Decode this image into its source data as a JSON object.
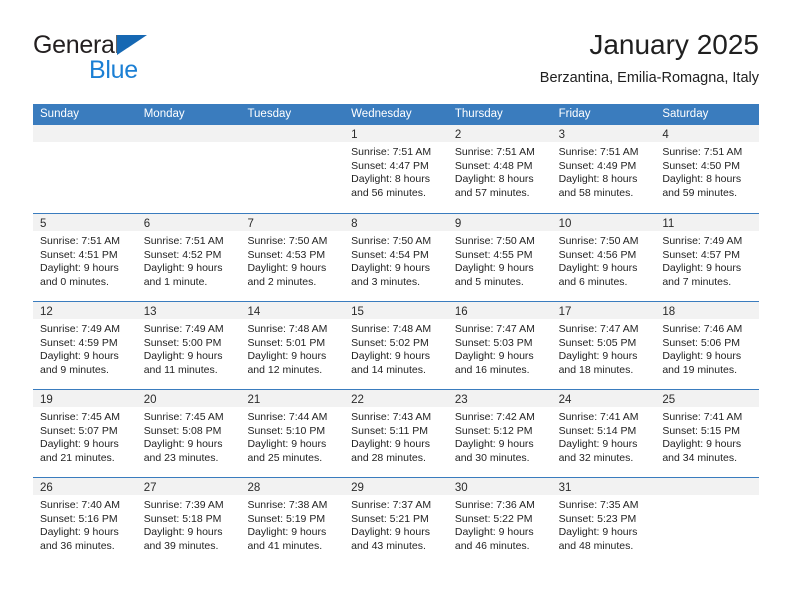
{
  "brand": {
    "line1": "General",
    "line2": "Blue",
    "triangle_color": "#1668b3",
    "line2_color": "#1b7fd4"
  },
  "header": {
    "title": "January 2025",
    "subtitle": "Berzantina, Emilia-Romagna, Italy"
  },
  "theme": {
    "header_blue": "#3a7cbe",
    "daynum_strip": "#f2f2f2",
    "text": "#232323"
  },
  "weekdays": [
    "Sunday",
    "Monday",
    "Tuesday",
    "Wednesday",
    "Thursday",
    "Friday",
    "Saturday"
  ],
  "weeks": [
    [
      {
        "day": "",
        "lines": []
      },
      {
        "day": "",
        "lines": []
      },
      {
        "day": "",
        "lines": []
      },
      {
        "day": "1",
        "lines": [
          "Sunrise: 7:51 AM",
          "Sunset: 4:47 PM",
          "Daylight: 8 hours",
          "and 56 minutes."
        ]
      },
      {
        "day": "2",
        "lines": [
          "Sunrise: 7:51 AM",
          "Sunset: 4:48 PM",
          "Daylight: 8 hours",
          "and 57 minutes."
        ]
      },
      {
        "day": "3",
        "lines": [
          "Sunrise: 7:51 AM",
          "Sunset: 4:49 PM",
          "Daylight: 8 hours",
          "and 58 minutes."
        ]
      },
      {
        "day": "4",
        "lines": [
          "Sunrise: 7:51 AM",
          "Sunset: 4:50 PM",
          "Daylight: 8 hours",
          "and 59 minutes."
        ]
      }
    ],
    [
      {
        "day": "5",
        "lines": [
          "Sunrise: 7:51 AM",
          "Sunset: 4:51 PM",
          "Daylight: 9 hours",
          "and 0 minutes."
        ]
      },
      {
        "day": "6",
        "lines": [
          "Sunrise: 7:51 AM",
          "Sunset: 4:52 PM",
          "Daylight: 9 hours",
          "and 1 minute."
        ]
      },
      {
        "day": "7",
        "lines": [
          "Sunrise: 7:50 AM",
          "Sunset: 4:53 PM",
          "Daylight: 9 hours",
          "and 2 minutes."
        ]
      },
      {
        "day": "8",
        "lines": [
          "Sunrise: 7:50 AM",
          "Sunset: 4:54 PM",
          "Daylight: 9 hours",
          "and 3 minutes."
        ]
      },
      {
        "day": "9",
        "lines": [
          "Sunrise: 7:50 AM",
          "Sunset: 4:55 PM",
          "Daylight: 9 hours",
          "and 5 minutes."
        ]
      },
      {
        "day": "10",
        "lines": [
          "Sunrise: 7:50 AM",
          "Sunset: 4:56 PM",
          "Daylight: 9 hours",
          "and 6 minutes."
        ]
      },
      {
        "day": "11",
        "lines": [
          "Sunrise: 7:49 AM",
          "Sunset: 4:57 PM",
          "Daylight: 9 hours",
          "and 7 minutes."
        ]
      }
    ],
    [
      {
        "day": "12",
        "lines": [
          "Sunrise: 7:49 AM",
          "Sunset: 4:59 PM",
          "Daylight: 9 hours",
          "and 9 minutes."
        ]
      },
      {
        "day": "13",
        "lines": [
          "Sunrise: 7:49 AM",
          "Sunset: 5:00 PM",
          "Daylight: 9 hours",
          "and 11 minutes."
        ]
      },
      {
        "day": "14",
        "lines": [
          "Sunrise: 7:48 AM",
          "Sunset: 5:01 PM",
          "Daylight: 9 hours",
          "and 12 minutes."
        ]
      },
      {
        "day": "15",
        "lines": [
          "Sunrise: 7:48 AM",
          "Sunset: 5:02 PM",
          "Daylight: 9 hours",
          "and 14 minutes."
        ]
      },
      {
        "day": "16",
        "lines": [
          "Sunrise: 7:47 AM",
          "Sunset: 5:03 PM",
          "Daylight: 9 hours",
          "and 16 minutes."
        ]
      },
      {
        "day": "17",
        "lines": [
          "Sunrise: 7:47 AM",
          "Sunset: 5:05 PM",
          "Daylight: 9 hours",
          "and 18 minutes."
        ]
      },
      {
        "day": "18",
        "lines": [
          "Sunrise: 7:46 AM",
          "Sunset: 5:06 PM",
          "Daylight: 9 hours",
          "and 19 minutes."
        ]
      }
    ],
    [
      {
        "day": "19",
        "lines": [
          "Sunrise: 7:45 AM",
          "Sunset: 5:07 PM",
          "Daylight: 9 hours",
          "and 21 minutes."
        ]
      },
      {
        "day": "20",
        "lines": [
          "Sunrise: 7:45 AM",
          "Sunset: 5:08 PM",
          "Daylight: 9 hours",
          "and 23 minutes."
        ]
      },
      {
        "day": "21",
        "lines": [
          "Sunrise: 7:44 AM",
          "Sunset: 5:10 PM",
          "Daylight: 9 hours",
          "and 25 minutes."
        ]
      },
      {
        "day": "22",
        "lines": [
          "Sunrise: 7:43 AM",
          "Sunset: 5:11 PM",
          "Daylight: 9 hours",
          "and 28 minutes."
        ]
      },
      {
        "day": "23",
        "lines": [
          "Sunrise: 7:42 AM",
          "Sunset: 5:12 PM",
          "Daylight: 9 hours",
          "and 30 minutes."
        ]
      },
      {
        "day": "24",
        "lines": [
          "Sunrise: 7:41 AM",
          "Sunset: 5:14 PM",
          "Daylight: 9 hours",
          "and 32 minutes."
        ]
      },
      {
        "day": "25",
        "lines": [
          "Sunrise: 7:41 AM",
          "Sunset: 5:15 PM",
          "Daylight: 9 hours",
          "and 34 minutes."
        ]
      }
    ],
    [
      {
        "day": "26",
        "lines": [
          "Sunrise: 7:40 AM",
          "Sunset: 5:16 PM",
          "Daylight: 9 hours",
          "and 36 minutes."
        ]
      },
      {
        "day": "27",
        "lines": [
          "Sunrise: 7:39 AM",
          "Sunset: 5:18 PM",
          "Daylight: 9 hours",
          "and 39 minutes."
        ]
      },
      {
        "day": "28",
        "lines": [
          "Sunrise: 7:38 AM",
          "Sunset: 5:19 PM",
          "Daylight: 9 hours",
          "and 41 minutes."
        ]
      },
      {
        "day": "29",
        "lines": [
          "Sunrise: 7:37 AM",
          "Sunset: 5:21 PM",
          "Daylight: 9 hours",
          "and 43 minutes."
        ]
      },
      {
        "day": "30",
        "lines": [
          "Sunrise: 7:36 AM",
          "Sunset: 5:22 PM",
          "Daylight: 9 hours",
          "and 46 minutes."
        ]
      },
      {
        "day": "31",
        "lines": [
          "Sunrise: 7:35 AM",
          "Sunset: 5:23 PM",
          "Daylight: 9 hours",
          "and 48 minutes."
        ]
      },
      {
        "day": "",
        "lines": []
      }
    ]
  ]
}
